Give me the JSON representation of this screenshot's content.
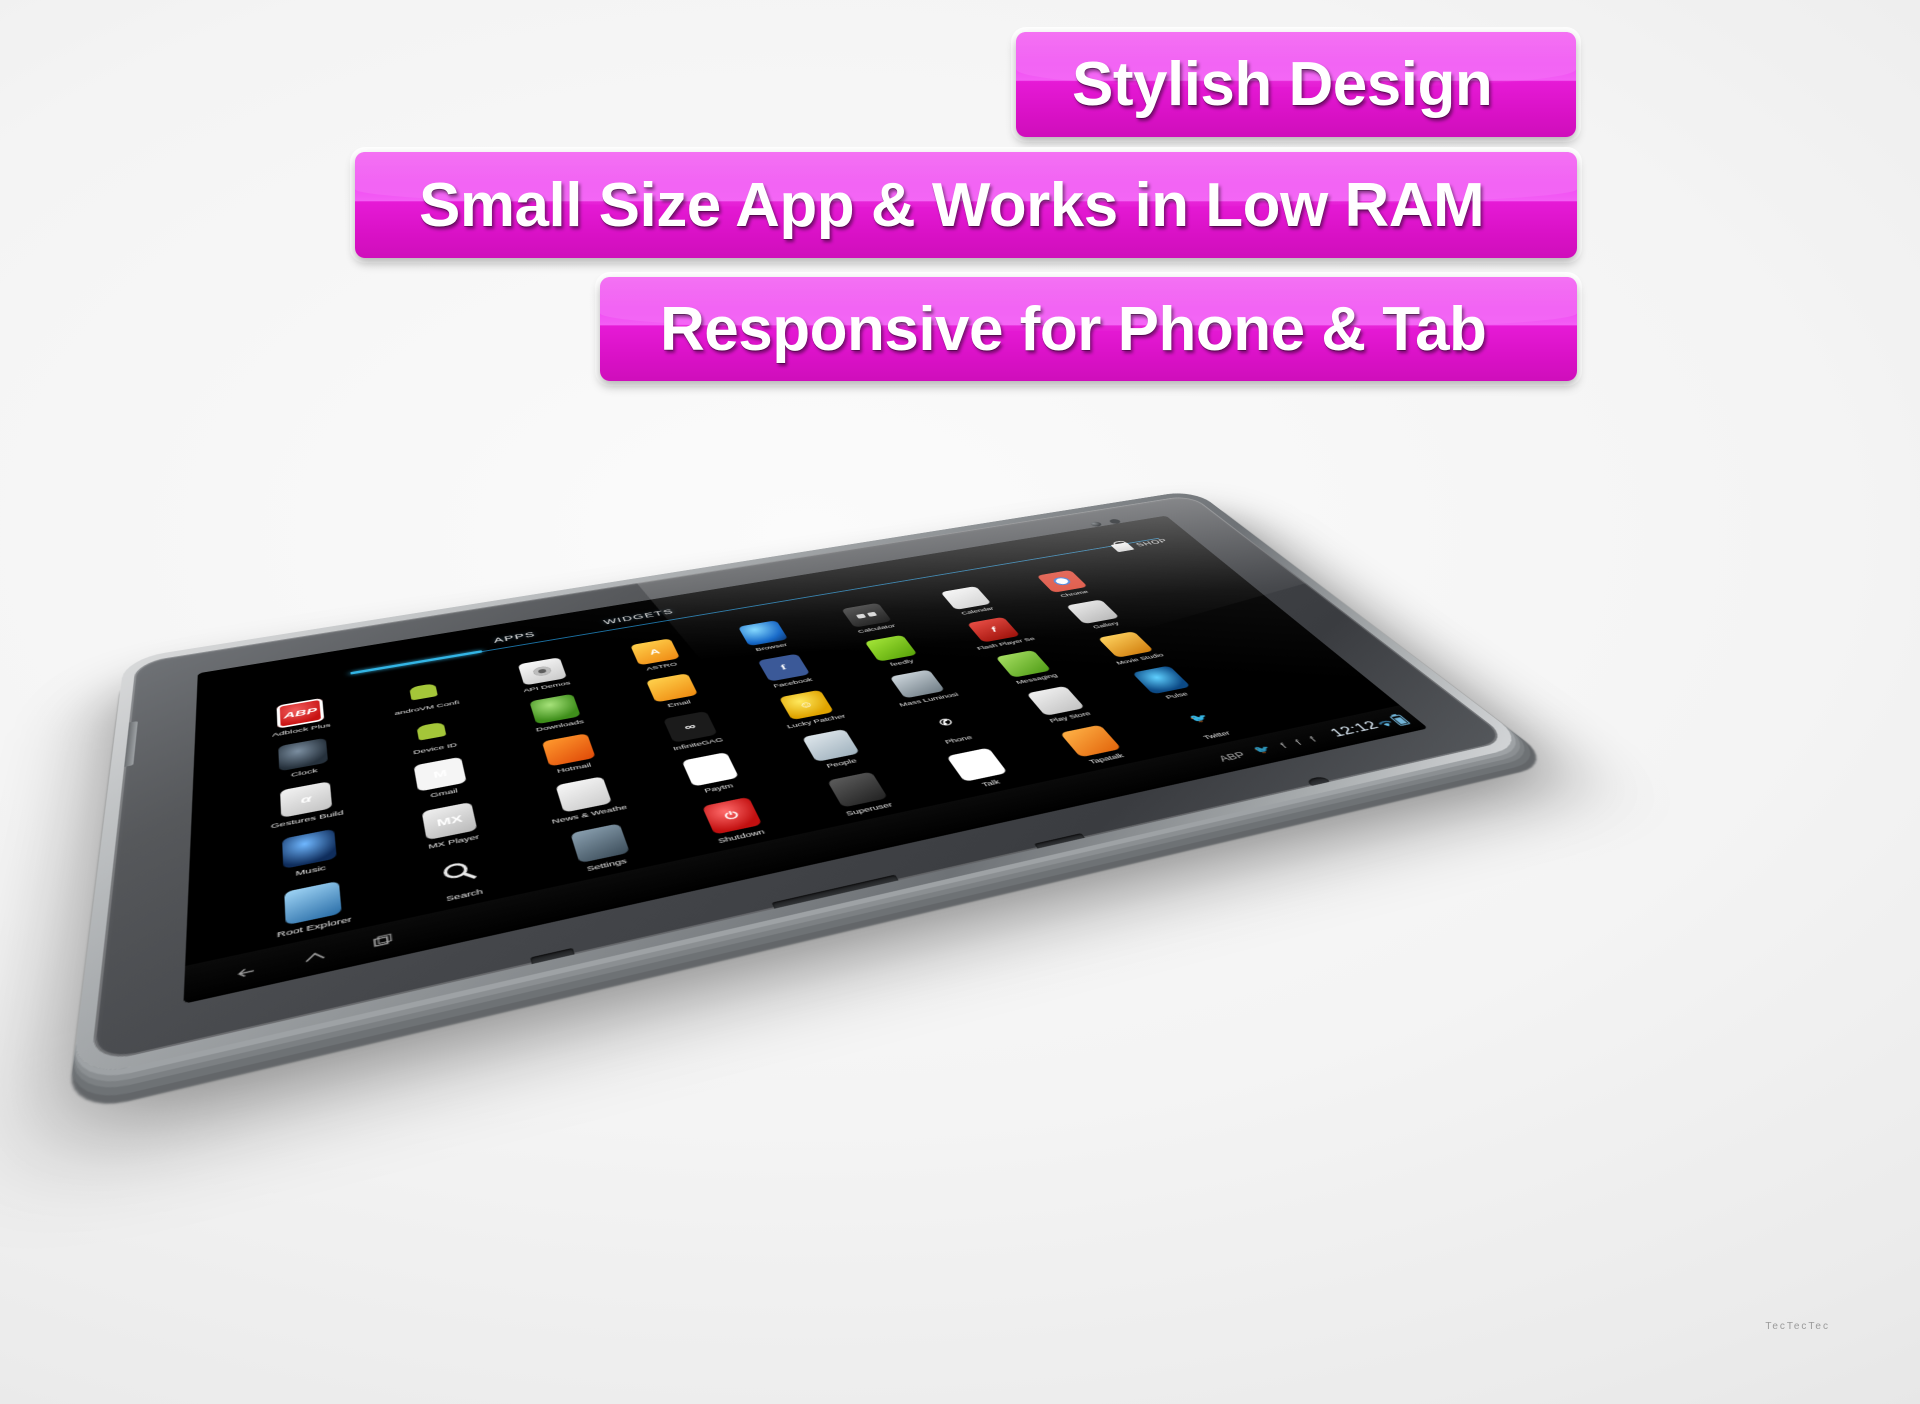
{
  "banners": [
    {
      "id": "banner-1",
      "text": "Stylish Design"
    },
    {
      "id": "banner-2",
      "text": "Small Size App & Works in Low RAM"
    },
    {
      "id": "banner-3",
      "text": "Responsive for Phone & Tab"
    }
  ],
  "colors": {
    "banner_magenta_top": "#f35ef5",
    "banner_magenta_bottom": "#cf0ebb",
    "banner_text": "#ffffff",
    "accent_blue": "#33b5e5",
    "screen_black": "#000000",
    "background_gray": "#ebebeb"
  },
  "device": {
    "type": "android-tablet",
    "brand_caption": "TecTecTec"
  },
  "launcher": {
    "tabs": [
      {
        "label": "APPS",
        "active": true
      },
      {
        "label": "WIDGETS",
        "active": false
      }
    ],
    "shop": {
      "label": "SHOP",
      "icon": "shopping-bag-icon"
    },
    "apps": [
      {
        "label": "Adblock Plus",
        "icon": "abp-icon",
        "glyph": "ABP",
        "cls": "ic-abp"
      },
      {
        "label": "androVM Confi",
        "icon": "androvm-icon",
        "glyph": "",
        "cls": "ic-andro"
      },
      {
        "label": "API Demos",
        "icon": "api-demos-icon",
        "glyph": "",
        "cls": "ic-folderg"
      },
      {
        "label": "ASTRO",
        "icon": "astro-icon",
        "glyph": "A",
        "cls": "ic-astro"
      },
      {
        "label": "Browser",
        "icon": "browser-icon",
        "glyph": "",
        "cls": "ic-browser"
      },
      {
        "label": "Calculator",
        "icon": "calculator-icon",
        "glyph": "",
        "cls": "ic-calc"
      },
      {
        "label": "Calendar",
        "icon": "calendar-icon",
        "glyph": "",
        "cls": "ic-calendar"
      },
      {
        "label": "Chrome",
        "icon": "chrome-icon",
        "glyph": "",
        "cls": "ic-chrome"
      },
      {
        "label": "",
        "icon": "spacer-icon",
        "glyph": "",
        "cls": "ic-spacer"
      },
      {
        "label": "Clock",
        "icon": "clock-icon",
        "glyph": "",
        "cls": "ic-clock"
      },
      {
        "label": "Device ID",
        "icon": "device-id-icon",
        "glyph": "",
        "cls": "ic-deviceid"
      },
      {
        "label": "Downloads",
        "icon": "downloads-icon",
        "glyph": "",
        "cls": "ic-down"
      },
      {
        "label": "Email",
        "icon": "email-icon",
        "glyph": "",
        "cls": "ic-email"
      },
      {
        "label": "Facebook",
        "icon": "facebook-icon",
        "glyph": "f",
        "cls": "ic-fb"
      },
      {
        "label": "feedly",
        "icon": "feedly-icon",
        "glyph": "",
        "cls": "ic-feedly"
      },
      {
        "label": "Flash Player Se",
        "icon": "flash-player-icon",
        "glyph": "f",
        "cls": "ic-flash"
      },
      {
        "label": "Gallery",
        "icon": "gallery-icon",
        "glyph": "",
        "cls": "ic-gallery"
      },
      {
        "label": "",
        "icon": "spacer-icon",
        "glyph": "",
        "cls": "ic-spacer"
      },
      {
        "label": "Gestures Build",
        "icon": "gestures-builder-icon",
        "glyph": "α",
        "cls": "ic-gestures"
      },
      {
        "label": "Gmail",
        "icon": "gmail-icon",
        "glyph": "M",
        "cls": "ic-gmail"
      },
      {
        "label": "Hotmail",
        "icon": "hotmail-icon",
        "glyph": "",
        "cls": "ic-hotmail"
      },
      {
        "label": "InfiniteGAG",
        "icon": "infinitegag-icon",
        "glyph": "∞",
        "cls": "ic-9gag"
      },
      {
        "label": "Lucky Patcher",
        "icon": "lucky-patcher-icon",
        "glyph": "☺",
        "cls": "ic-lucky"
      },
      {
        "label": "Mass Luminosi",
        "icon": "mass-luminosity-icon",
        "glyph": "",
        "cls": "ic-mass"
      },
      {
        "label": "Messaging",
        "icon": "messaging-icon",
        "glyph": "",
        "cls": "ic-messaging"
      },
      {
        "label": "Movie Studio",
        "icon": "movie-studio-icon",
        "glyph": "",
        "cls": "ic-movie"
      },
      {
        "label": "",
        "icon": "spacer-icon",
        "glyph": "",
        "cls": "ic-spacer"
      },
      {
        "label": "Music",
        "icon": "music-icon",
        "glyph": "",
        "cls": "ic-music"
      },
      {
        "label": "MX Player",
        "icon": "mx-player-icon",
        "glyph": "MX",
        "cls": "ic-mx"
      },
      {
        "label": "News & Weathe",
        "icon": "news-weather-icon",
        "glyph": "",
        "cls": "ic-news"
      },
      {
        "label": "Paytm",
        "icon": "paytm-icon",
        "glyph": "Paytm",
        "cls": "ic-paytm"
      },
      {
        "label": "People",
        "icon": "people-icon",
        "glyph": "",
        "cls": "ic-people"
      },
      {
        "label": "Phone",
        "icon": "phone-icon",
        "glyph": "✆",
        "cls": "ic-phone"
      },
      {
        "label": "Play Store",
        "icon": "play-store-icon",
        "glyph": "",
        "cls": "ic-play"
      },
      {
        "label": "Pulse",
        "icon": "pulse-icon",
        "glyph": "",
        "cls": "ic-pulse"
      },
      {
        "label": "",
        "icon": "spacer-icon",
        "glyph": "",
        "cls": "ic-spacer"
      },
      {
        "label": "Root Explorer",
        "icon": "root-explorer-icon",
        "glyph": "",
        "cls": "ic-root"
      },
      {
        "label": "Search",
        "icon": "search-icon",
        "glyph": "",
        "cls": "ic-search"
      },
      {
        "label": "Settings",
        "icon": "settings-icon",
        "glyph": "",
        "cls": "ic-settings"
      },
      {
        "label": "Shutdown",
        "icon": "shutdown-icon",
        "glyph": "⏻",
        "cls": "ic-shutdown"
      },
      {
        "label": "Superuser",
        "icon": "superuser-icon",
        "glyph": "",
        "cls": "ic-superuser"
      },
      {
        "label": "Talk",
        "icon": "talk-icon",
        "glyph": "talk",
        "cls": "ic-talk"
      },
      {
        "label": "Tapatalk",
        "icon": "tapatalk-icon",
        "glyph": "",
        "cls": "ic-tapatalk"
      },
      {
        "label": "Twitter",
        "icon": "twitter-icon",
        "glyph": "🐦",
        "cls": "ic-twitter"
      },
      {
        "label": "",
        "icon": "spacer-icon",
        "glyph": "",
        "cls": "ic-spacer"
      }
    ],
    "statusbar": {
      "nav": [
        {
          "icon": "back-icon"
        },
        {
          "icon": "home-icon"
        },
        {
          "icon": "recents-icon"
        }
      ],
      "notifications": [
        {
          "icon": "abp-status-icon",
          "glyph": "ABP"
        },
        {
          "icon": "twitter-status-icon",
          "glyph": "🐦"
        },
        {
          "icon": "facebook-status-icon",
          "glyph": "f"
        },
        {
          "icon": "facebook-status-icon-2",
          "glyph": "f"
        },
        {
          "icon": "facebook-status-icon-3",
          "glyph": "f"
        }
      ],
      "time": "12:12",
      "wifi_icon": "wifi-icon",
      "battery_icon": "battery-icon"
    }
  }
}
